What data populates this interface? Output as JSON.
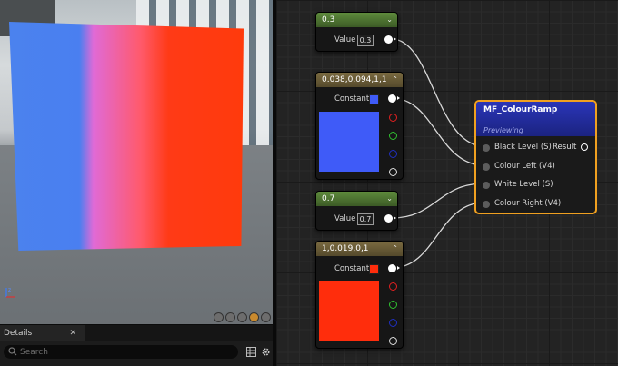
{
  "viewport": {
    "axis_label": "z",
    "tool_icons": [
      "sphere-preview-icon",
      "cylinder-preview-icon",
      "plane-preview-icon",
      "cube-preview-icon",
      "mesh-preview-icon"
    ],
    "active_tool_index": 3,
    "plane_gradient": [
      "#4b82ee",
      "#e06ad6",
      "#ff3a16"
    ]
  },
  "details": {
    "tab_label": "Details",
    "close_glyph": "✕",
    "search_placeholder": "Search"
  },
  "nodes": {
    "scalar_black": {
      "title": "0.3",
      "prop_label": "Value",
      "value": "0.3",
      "collapse_glyph": "⌄"
    },
    "vector_left": {
      "title": "0.038,0.094,1,1",
      "prop_label": "Constant",
      "color": "#3f5bf8",
      "collapse_glyph": "⌃"
    },
    "scalar_white": {
      "title": "0.7",
      "prop_label": "Value",
      "value": "0.7",
      "collapse_glyph": "⌄"
    },
    "vector_right": {
      "title": "1,0.019,0,1",
      "prop_label": "Constant",
      "color": "#ff2d0c",
      "collapse_glyph": "⌃"
    }
  },
  "colour_ramp": {
    "title": "MF_ColourRamp",
    "subtitle": "Previewing",
    "inputs": [
      "Black Level (S)",
      "Colour Left (V4)",
      "White Level (S)",
      "Colour Right (V4)"
    ],
    "output": "Result"
  },
  "colors": {
    "accent_orange": "#f0a020",
    "pin_red": "#e02020",
    "pin_green": "#30c030",
    "pin_blue": "#2030c0"
  }
}
